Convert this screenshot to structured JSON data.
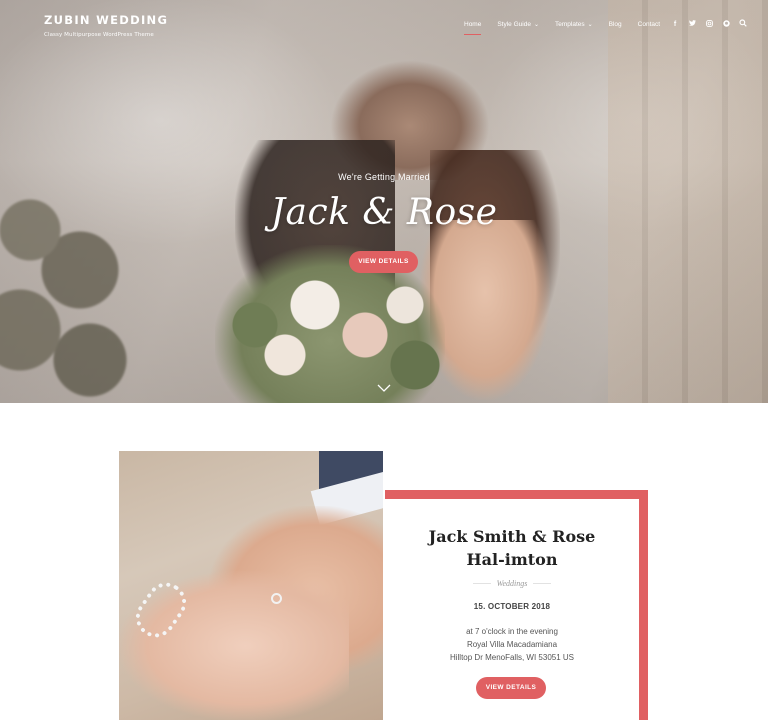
{
  "site": {
    "name": "ZUBIN WEDDING",
    "tagline": "Classy Multipurpose WordPress Theme"
  },
  "nav": {
    "items": [
      {
        "label": "Home",
        "active": true,
        "dropdown": false
      },
      {
        "label": "Style Guide",
        "active": false,
        "dropdown": true
      },
      {
        "label": "Templates",
        "active": false,
        "dropdown": true
      },
      {
        "label": "Blog",
        "active": false,
        "dropdown": false
      },
      {
        "label": "Contact",
        "active": false,
        "dropdown": false
      }
    ],
    "social": [
      {
        "icon": "facebook-icon",
        "glyph": "f"
      },
      {
        "icon": "twitter-icon",
        "glyph": "t"
      },
      {
        "icon": "instagram-icon",
        "glyph": "◎"
      },
      {
        "icon": "github-icon",
        "glyph": "●"
      }
    ],
    "search_icon": "search-icon"
  },
  "hero": {
    "subtitle": "We're Getting Married",
    "title": "Jack & Rose",
    "button": "VIEW DETAILS",
    "scroll_icon": "chevron-down-icon"
  },
  "event": {
    "title": "Jack Smith & Rose Hal-imton",
    "category": "Weddings",
    "date": "15. OCTOBER 2018",
    "time": "at 7 o'clock in the evening",
    "venue": "Royal Villa Macadamiana",
    "address": "Hilltop Dr MenoFalls, WI 53051 US",
    "button": "VIEW DETAILS"
  },
  "colors": {
    "accent": "#e06062",
    "text_dark": "#222222",
    "white": "#ffffff"
  }
}
